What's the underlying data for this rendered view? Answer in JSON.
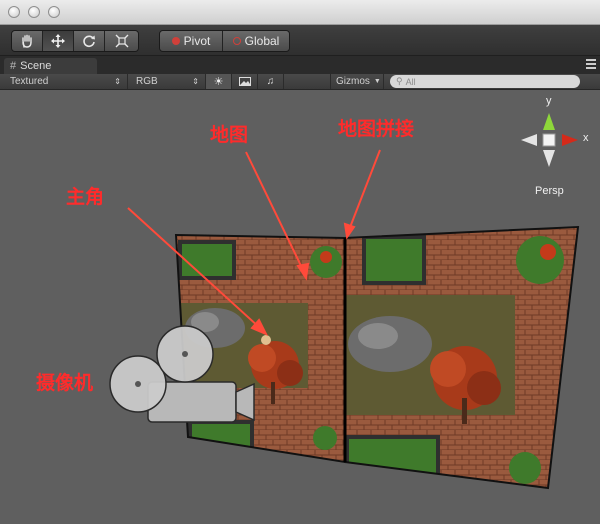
{
  "toolbar": {
    "pivot_label": "Pivot",
    "global_label": "Global"
  },
  "tabs": [
    {
      "label": "Scene"
    }
  ],
  "scene_toolbar": {
    "draw_mode": "Textured",
    "render_mode": "RGB",
    "gizmos_label": "Gizmos",
    "search_placeholder": "All"
  },
  "gizmo": {
    "x_label": "x",
    "y_label": "y",
    "view_label": "Persp"
  },
  "annotations": {
    "map": "地图",
    "map_stitch": "地图拼接",
    "protagonist": "主角",
    "camera": "摄像机"
  },
  "colors": {
    "annotation": "#ff2b2b",
    "gizmo_x": "#d42a1a",
    "gizmo_y": "#8ed83a",
    "brick": "#9a5a3e",
    "hedge": "#3f7a2b",
    "dirt": "#5e5a33"
  },
  "icons": [
    "hand-icon",
    "move-icon",
    "rotate-icon",
    "scale-icon",
    "sun-icon",
    "image-icon",
    "audio-icon",
    "search-icon",
    "tab-menu-icon",
    "camera-icon"
  ]
}
